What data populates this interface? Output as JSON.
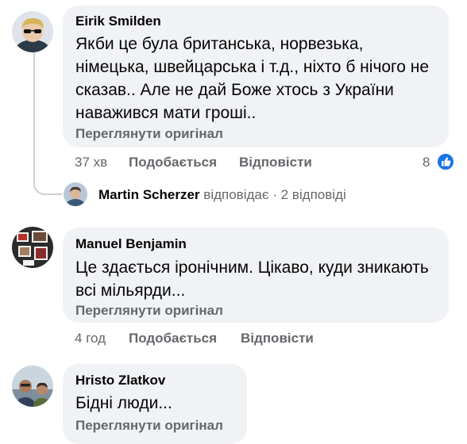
{
  "comments": [
    {
      "author": "Eirik Smilden",
      "lines": [
        "Якби це була британська, норвезька,",
        "німецька, швейцарська і т.д., ніхто б нічого не",
        "сказав.. Але не дай Боже хтось з України",
        "наважився мати гроші.."
      ],
      "see_original": "Переглянути оригінал",
      "time": "37 хв",
      "like": "Подобається",
      "reply": "Відповісти",
      "reaction_count": "8",
      "reaction_icon": "like-icon",
      "reaction_color": "#1b74e4"
    },
    {
      "author": "Manuel Benjamin",
      "lines": [
        "Це здається іронічним. Цікаво, куди зникають",
        "всі мільярди..."
      ],
      "see_original": "Переглянути оригінал",
      "time": "4 год",
      "like": "Подобається",
      "reply": "Відповісти"
    },
    {
      "author": "Hristo Zlatkov",
      "lines": [
        "Бідні люди..."
      ],
      "see_original": "Переглянути оригінал"
    }
  ],
  "reply_summary": {
    "author": "Martin Scherzer",
    "action": "відповідає",
    "separator": "·",
    "count": "2 відповіді"
  },
  "colors": {
    "bubble": "#f0f2f5",
    "secondary_text": "#65676b",
    "primary_text": "#050505"
  }
}
